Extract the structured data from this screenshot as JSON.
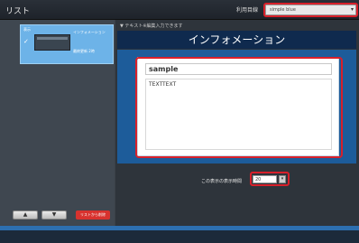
{
  "topbar": {
    "title": "リスト",
    "template_label": "利用目線",
    "template_value": "simple blue"
  },
  "sidebar": {
    "item": {
      "badge": "表示",
      "name": "インフォメーション",
      "date": "最終更新 2時"
    },
    "up_label": "▲",
    "down_label": "▼",
    "delete_label": "リストから削除"
  },
  "main": {
    "hint": "▼ テキスト※編集入力できます",
    "header_title": "インフォメーション",
    "card": {
      "title_value": "sample",
      "text_value": "TEXTTEXT"
    },
    "display": {
      "label": "この表示の表示時間",
      "value": "20"
    }
  },
  "colors": {
    "accent_highlight": "#d8202a",
    "header_navy": "#0f2a4e",
    "panel_blue": "#1d5c9a",
    "sidebar_item": "#6db3e8"
  }
}
